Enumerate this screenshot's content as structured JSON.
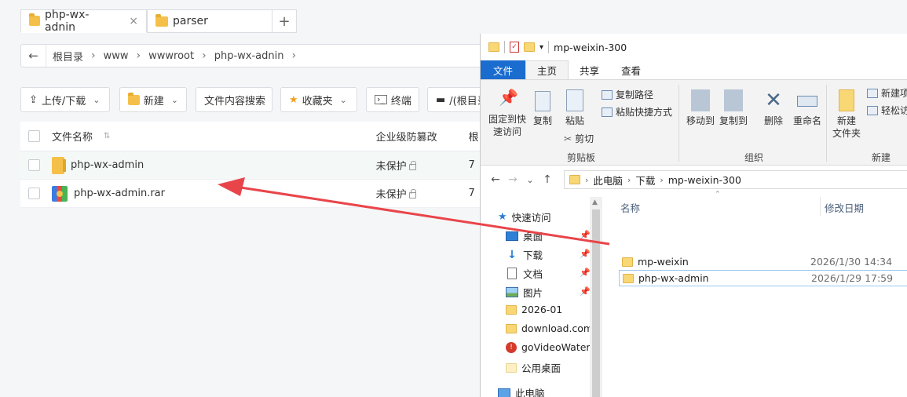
{
  "tabs": [
    {
      "label": "php-wx-adnin",
      "close": "×"
    },
    {
      "label": "parser"
    }
  ],
  "tab_add": "+",
  "address": {
    "back": "←",
    "crumbs": [
      "根目录",
      "www",
      "wwwroot",
      "php-wx-adnin"
    ],
    "sep": "›"
  },
  "toolbar": {
    "upload": "上传/下载",
    "new": "新建",
    "search": "文件内容搜索",
    "favorites": "收藏夹",
    "terminal": "终端",
    "root": "/(根目录"
  },
  "table": {
    "col_name": "文件名称",
    "col_protect": "企业级防篡改",
    "col_extra": "根",
    "rows": [
      {
        "name": "php-wx-admin",
        "protect": "未保护",
        "extra": "7"
      },
      {
        "name": "php-wx-admin.rar",
        "protect": "未保护",
        "extra": "7"
      }
    ]
  },
  "explorer": {
    "title": "mp-weixin-300",
    "tabs": [
      "文件",
      "主页",
      "共享",
      "查看"
    ],
    "ribbon": {
      "pin": "固定到快\n速访问",
      "pin_l1": "固定到快",
      "pin_l2": "速访问",
      "copy": "复制",
      "paste": "粘贴",
      "copy_path": "复制路径",
      "paste_shortcut": "粘贴快捷方式",
      "cut": "剪切",
      "clipboard": "剪贴板",
      "move_to": "移动到",
      "copy_to": "复制到",
      "delete": "删除",
      "rename": "重命名",
      "organize": "组织",
      "new_folder_l1": "新建",
      "new_folder_l2": "文件夹",
      "new_item": "新建项",
      "easy_access": "轻松访",
      "new_group": "新建"
    },
    "nav": {
      "back": "←",
      "forward": "→",
      "down": "⌄",
      "up": "↑"
    },
    "path": [
      "此电脑",
      "下载",
      "mp-weixin-300"
    ],
    "sidebar": [
      {
        "label": "快速访问",
        "icon": "star-icon"
      },
      {
        "label": "桌面",
        "icon": "desktop-icon",
        "pinned": true
      },
      {
        "label": "下载",
        "icon": "download-icon",
        "pinned": true
      },
      {
        "label": "文档",
        "icon": "document-icon",
        "pinned": true
      },
      {
        "label": "图片",
        "icon": "picture-icon",
        "pinned": true
      },
      {
        "label": "2026-01",
        "icon": "folder-icon"
      },
      {
        "label": "download.com",
        "icon": "folder-icon"
      },
      {
        "label": "goVideoWater",
        "icon": "app-icon"
      },
      {
        "label": "公用桌面",
        "icon": "folder-icon"
      },
      {
        "label": "此电脑",
        "icon": "pc-icon"
      }
    ],
    "columns": {
      "name": "名称",
      "modified": "修改日期"
    },
    "files": [
      {
        "name": "mp-weixin",
        "date": "2026/1/30 14:34"
      },
      {
        "name": "php-wx-admin",
        "date": "2026/1/29 17:59"
      }
    ]
  },
  "colors": {
    "accent_blue": "#1a6ccf",
    "arrow_red": "#e8454a",
    "folder_yellow": "#f5c04a"
  }
}
